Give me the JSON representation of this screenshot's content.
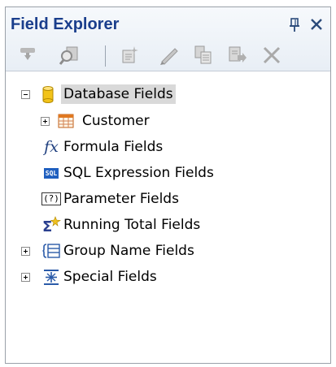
{
  "panel": {
    "title": "Field Explorer",
    "pin_glyph": "📌",
    "close_glyph": "✕"
  },
  "toolbar": {
    "buttons": [
      {
        "name": "insert-to-report",
        "icon": "insert-down-arrow-icon"
      },
      {
        "name": "browse",
        "icon": "browse-icon"
      },
      {
        "name": "new",
        "icon": "new-field-icon"
      },
      {
        "name": "edit",
        "icon": "pencil-icon"
      },
      {
        "name": "duplicate",
        "icon": "duplicate-icon"
      },
      {
        "name": "rename",
        "icon": "rename-icon"
      },
      {
        "name": "delete",
        "icon": "delete-x-icon"
      }
    ]
  },
  "tree": {
    "database_fields": "Database Fields",
    "customer": "Customer",
    "formula_fields": "Formula Fields",
    "sql_expression_fields": "SQL Expression Fields",
    "parameter_fields": "Parameter Fields",
    "running_total_fields": "Running Total Fields",
    "group_name_fields": "Group Name Fields",
    "special_fields": "Special Fields",
    "sql_badge": "SQL",
    "param_badge": "(?)",
    "fx_glyph": "fx"
  },
  "colors": {
    "title": "#1a3e8c",
    "selection": "#d9d9d9",
    "database_cylinder": "#f2c31a",
    "sql_badge_bg": "#1f5fbf",
    "disabled_icon": "#a9a9a9"
  }
}
